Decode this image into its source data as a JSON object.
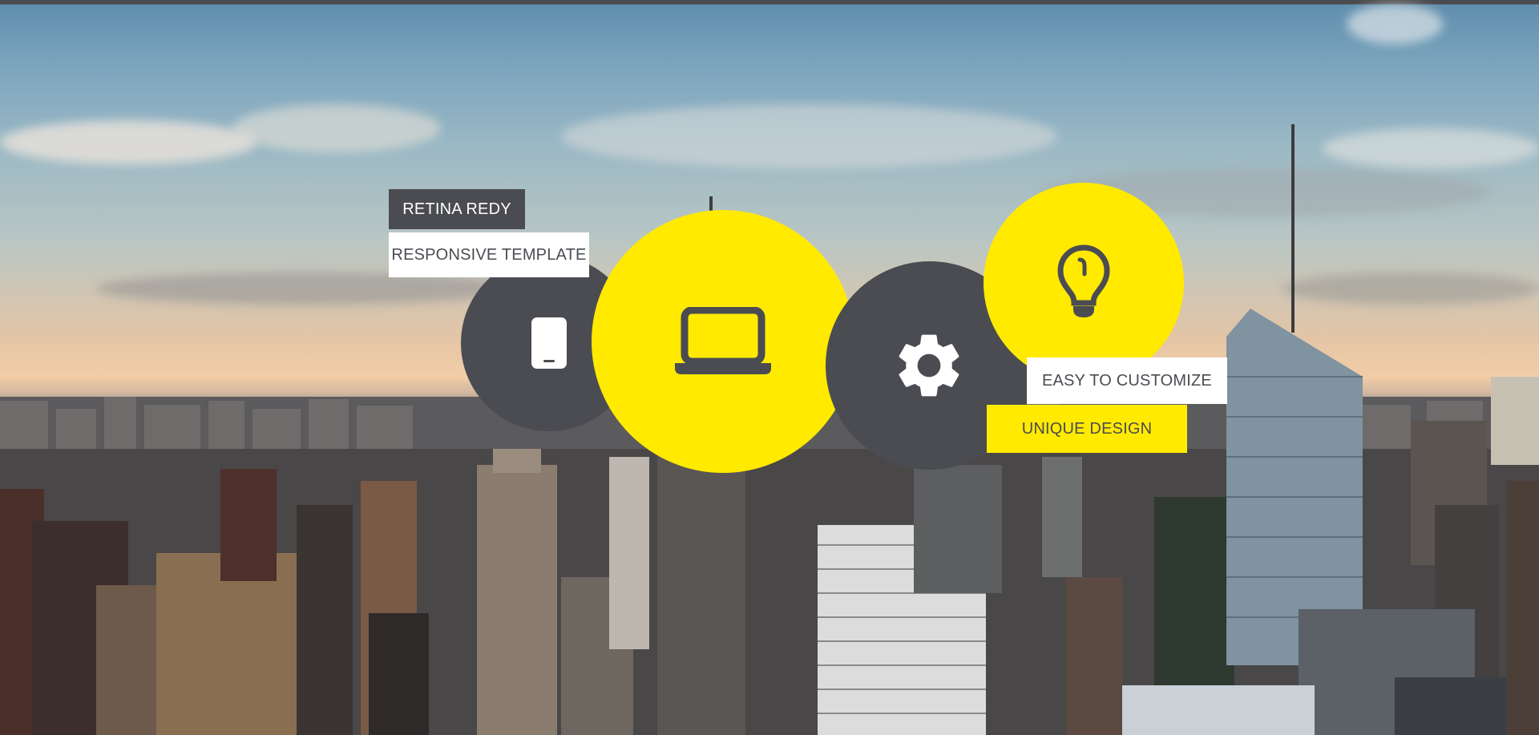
{
  "features": {
    "mobile": {
      "icon": "mobile-phone-icon"
    },
    "laptop": {
      "icon": "laptop-icon"
    },
    "settings": {
      "icon": "gear-icon"
    },
    "idea": {
      "icon": "lightbulb-icon"
    }
  },
  "labels": {
    "retina": "RETINA REDY",
    "responsive": "RESPONSIVE TEMPLATE",
    "customize": "EASY TO CUSTOMIZE",
    "unique": "UNIQUE DESIGN"
  },
  "colors": {
    "accent_yellow": "#ffea00",
    "dark_gray": "#4b4c52",
    "white": "#ffffff"
  }
}
